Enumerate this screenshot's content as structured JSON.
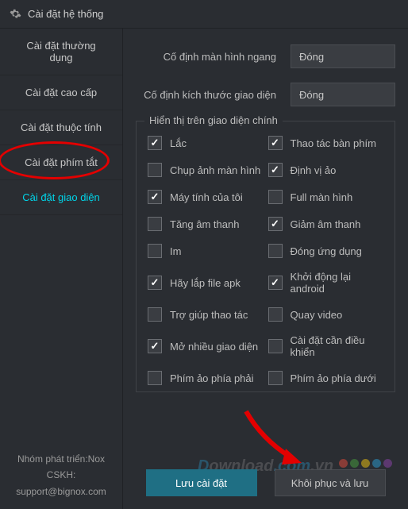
{
  "header": {
    "title": "Cài đặt hệ thống"
  },
  "sidebar": {
    "items": [
      {
        "label": "Cài đặt thường dụng"
      },
      {
        "label": "Cài đặt cao cấp"
      },
      {
        "label": "Cài đặt thuộc tính"
      },
      {
        "label": "Cài đặt phím tắt"
      },
      {
        "label": "Cài đặt giao diện"
      }
    ],
    "footer": {
      "line1": "Nhóm phát triển:Nox",
      "line2": "CSKH:",
      "line3": "support@bignox.com"
    }
  },
  "main": {
    "rows": [
      {
        "label": "Cố định màn hình ngang",
        "value": "Đóng"
      },
      {
        "label": "Cố định kích thước giao diện",
        "value": "Đóng"
      }
    ],
    "fieldset_title": "Hiển thị trên giao diện chính",
    "checks": [
      {
        "label": "Lắc",
        "checked": true
      },
      {
        "label": "Thao tác bàn phím",
        "checked": true
      },
      {
        "label": "Chụp ảnh màn hình",
        "checked": false
      },
      {
        "label": "Định vị ảo",
        "checked": true
      },
      {
        "label": "Máy tính của tôi",
        "checked": true
      },
      {
        "label": "Full màn hình",
        "checked": false
      },
      {
        "label": "Tăng âm thanh",
        "checked": false
      },
      {
        "label": "Giảm âm thanh",
        "checked": true
      },
      {
        "label": "Im",
        "checked": false
      },
      {
        "label": "Đóng ứng dụng",
        "checked": false
      },
      {
        "label": "Hãy lắp file apk",
        "checked": true
      },
      {
        "label": "Khởi động lại android",
        "checked": true
      },
      {
        "label": "Trợ giúp thao tác",
        "checked": false
      },
      {
        "label": "Quay video",
        "checked": false
      },
      {
        "label": "Mở nhiều giao diện",
        "checked": true
      },
      {
        "label": "Cài đặt cần điều khiển",
        "checked": false
      },
      {
        "label": "Phím ảo phía phải",
        "checked": false
      },
      {
        "label": "Phím ảo phía dưới",
        "checked": false
      }
    ]
  },
  "buttons": {
    "save": "Lưu cài đặt",
    "restore": "Khôi phục và lưu"
  },
  "watermark": {
    "text": "Download.com.vn"
  },
  "colors": {
    "dots": [
      "#e74c3c",
      "#48a23f",
      "#f1c40f",
      "#2a9fd6",
      "#8e44ad"
    ]
  }
}
